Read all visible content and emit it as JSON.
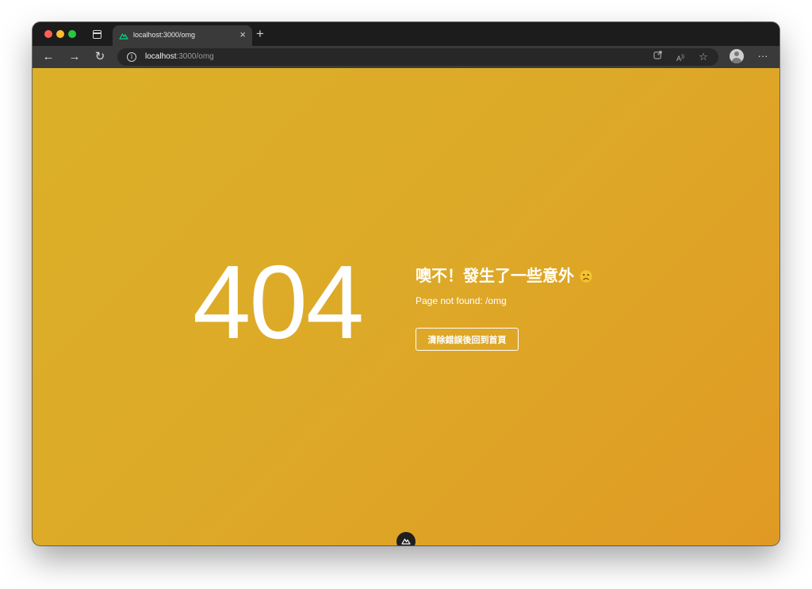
{
  "browser": {
    "tab": {
      "title": "localhost:3000/omg",
      "close_glyph": "×",
      "favicon": "nuxt-logo-icon"
    },
    "new_tab_glyph": "+",
    "toolbar": {
      "back_glyph": "←",
      "forward_glyph": "→",
      "reload_glyph": "↻",
      "url_host": "localhost",
      "url_path": ":3000/omg",
      "menu_glyph": "···"
    },
    "icons": [
      "tab-actions-icon",
      "info-icon",
      "open-in-app-icon",
      "read-aloud-icon",
      "favorite-star-icon",
      "profile-avatar-icon"
    ]
  },
  "page": {
    "status_code": "404",
    "title": "噢不！發生了一些意外",
    "title_emoji": "sad-face-icon",
    "message": "Page not found: /omg",
    "home_button_label": "清除錯誤後回到首頁",
    "background_colors": [
      "#dbb028",
      "#e09a24"
    ]
  },
  "devtools": {
    "icon": "nuxt-devtools-icon"
  }
}
